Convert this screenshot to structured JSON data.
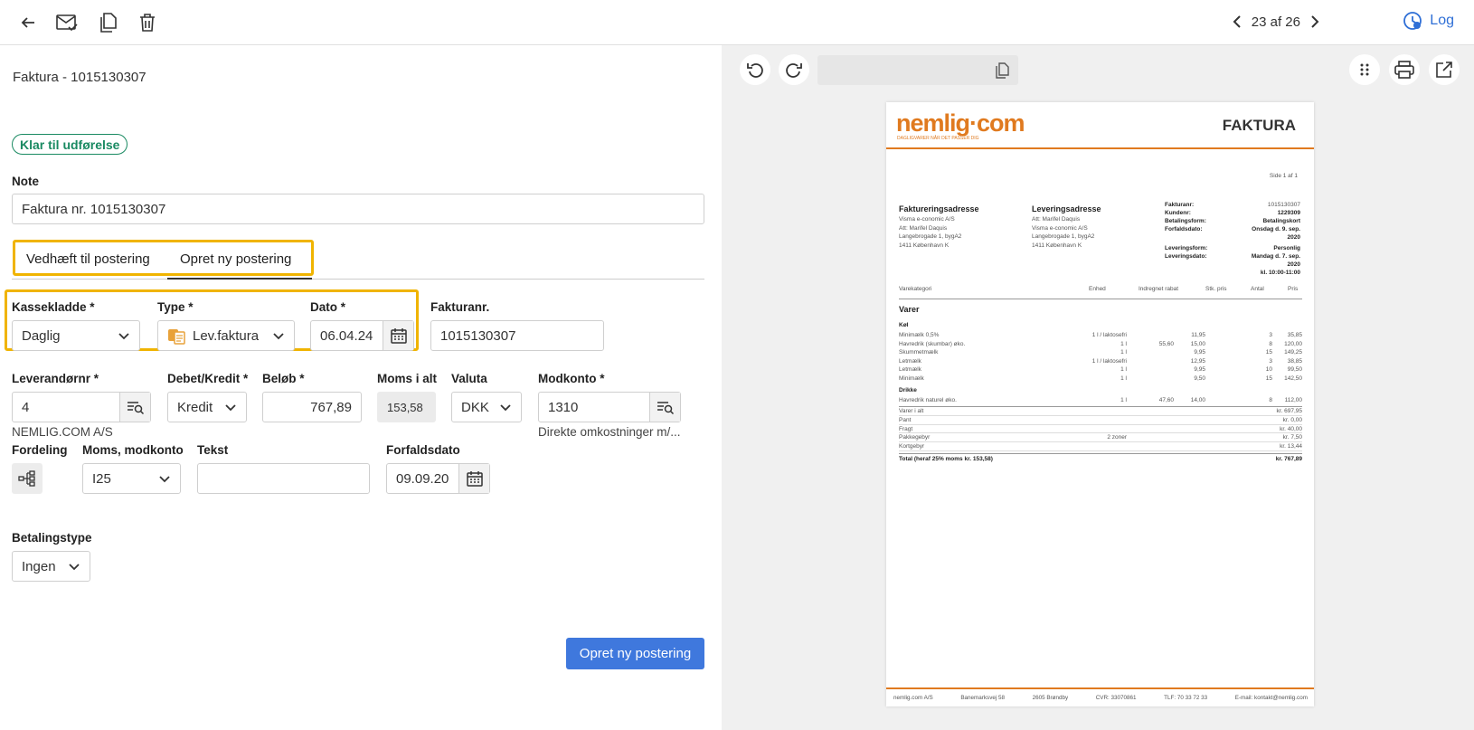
{
  "toolbar": {
    "back_icon": "arrow-left-icon",
    "email_icon": "envelope-check-icon",
    "copy_icon": "copy-icon",
    "delete_icon": "trash-icon"
  },
  "pager": {
    "text": "23 af 26",
    "log_label": "Log"
  },
  "header": {
    "title": "Faktura - 1015130307",
    "status": "Klar til udførelse"
  },
  "note": {
    "label": "Note",
    "value": "Faktura nr. 1015130307"
  },
  "tabs": [
    {
      "label": "Vedhæft til postering"
    },
    {
      "label": "Opret ny postering"
    }
  ],
  "form": {
    "kassekladde": {
      "label": "Kassekladde *",
      "value": "Daglig"
    },
    "type": {
      "label": "Type *",
      "value": "Lev.faktura"
    },
    "dato": {
      "label": "Dato *",
      "value": "06.04.24"
    },
    "fakturanr": {
      "label": "Fakturanr.",
      "value": "1015130307"
    },
    "leverandor": {
      "label": "Leverandørnr *",
      "value": "4",
      "sub": "NEMLIG.COM A/S"
    },
    "debet": {
      "label": "Debet/Kredit *",
      "value": "Kredit"
    },
    "belob": {
      "label": "Beløb *",
      "value": "767,89"
    },
    "moms_alt": {
      "label": "Moms i alt",
      "value": "153,58"
    },
    "valuta": {
      "label": "Valuta",
      "value": "DKK"
    },
    "modkonto": {
      "label": "Modkonto *",
      "value": "1310",
      "sub": "Direkte omkostninger m/..."
    },
    "fordeling": {
      "label": "Fordeling"
    },
    "moms_mod": {
      "label": "Moms, modkonto",
      "value": "I25"
    },
    "tekst": {
      "label": "Tekst",
      "value": ""
    },
    "forfald": {
      "label": "Forfaldsdato",
      "value": "09.09.20"
    },
    "betalingstype": {
      "label": "Betalingstype",
      "value": "Ingen"
    },
    "submit": "Opret ny postering"
  },
  "viewer": {
    "url": ""
  },
  "doc": {
    "logo": "nemlig·com",
    "tagline": "DAGLIGVARER NÅR   DET PASSER DIG",
    "title": "FAKTURA",
    "page": "Side 1 af 1",
    "billing_title": "Faktureringsadresse",
    "billing": [
      "Visma e-conomic A/S",
      "Att: Marifel Daquis",
      "Langebrogade 1,  bygA2",
      "1411 København K"
    ],
    "delivery_title": "Leveringsadresse",
    "delivery": [
      "Att: Marifel Daquis",
      "Visma e-conomic A/S",
      "Langebrogade 1,  bygA2",
      "1411 København K"
    ],
    "info": [
      [
        "Fakturanr:",
        "1015130307"
      ],
      [
        "Kundenr:",
        "1229309"
      ],
      [
        "Betalingsform:",
        "Betalingskort"
      ],
      [
        "Forfaldsdato:",
        "Onsdag d. 9. sep. 2020"
      ],
      [
        "Leveringsform:",
        "Personlig"
      ],
      [
        "Leveringsdato:",
        "Mandag d. 7. sep. 2020"
      ],
      [
        "",
        "kl. 10:00-11:00"
      ]
    ],
    "cols": [
      "Varekategori",
      "Enhed",
      "Indregnet rabat",
      "Stk. pris",
      "Antal",
      "Pris"
    ],
    "section": "Varer",
    "group1": "Køl",
    "rows1": [
      [
        "Minimælk 0,5%",
        "1 l / laktosefri",
        "",
        "11,95",
        "3",
        "35,85"
      ],
      [
        "Havredrik (skumbar) øko.",
        "1 l",
        "55,60",
        "15,00",
        "8",
        "120,00"
      ],
      [
        "Skummetmælk",
        "1 l",
        "",
        "9,95",
        "15",
        "149,25"
      ],
      [
        "Letmælk",
        "1 l / laktosefri",
        "",
        "12,95",
        "3",
        "38,85"
      ],
      [
        "Letmælk",
        "1 l",
        "",
        "9,95",
        "10",
        "99,50"
      ],
      [
        "Minimælk",
        "1 l",
        "",
        "9,50",
        "15",
        "142,50"
      ]
    ],
    "group2": "Drikke",
    "rows2": [
      [
        "Havredrik naturel øko.",
        "1 l",
        "47,60",
        "14,00",
        "8",
        "112,00"
      ]
    ],
    "totals": [
      [
        "Varer i alt",
        "",
        "kr. 697,95"
      ],
      [
        "Pant",
        "",
        "kr. 0,00"
      ],
      [
        "Fragt",
        "",
        "kr. 40,00"
      ],
      [
        "Pakkegebyr",
        "2 zoner",
        "kr. 7,50"
      ],
      [
        "Kortgebyr",
        "",
        "kr. 13,44"
      ]
    ],
    "grand": [
      "Total (heraf 25% moms kr. 153,58)",
      "kr. 767,89"
    ],
    "footer": [
      "nemlig.com A/S",
      "Banemarksvej 58",
      "2605 Brøndby",
      "CVR: 33070861",
      "TLF: 70 33 72 33",
      "E-mail: kontakt@nemlig.com"
    ]
  },
  "colors": {
    "accent": "#2f6fd6",
    "highlight": "#f0b400",
    "status": "#1a8a62",
    "brand": "#e07a1f"
  }
}
